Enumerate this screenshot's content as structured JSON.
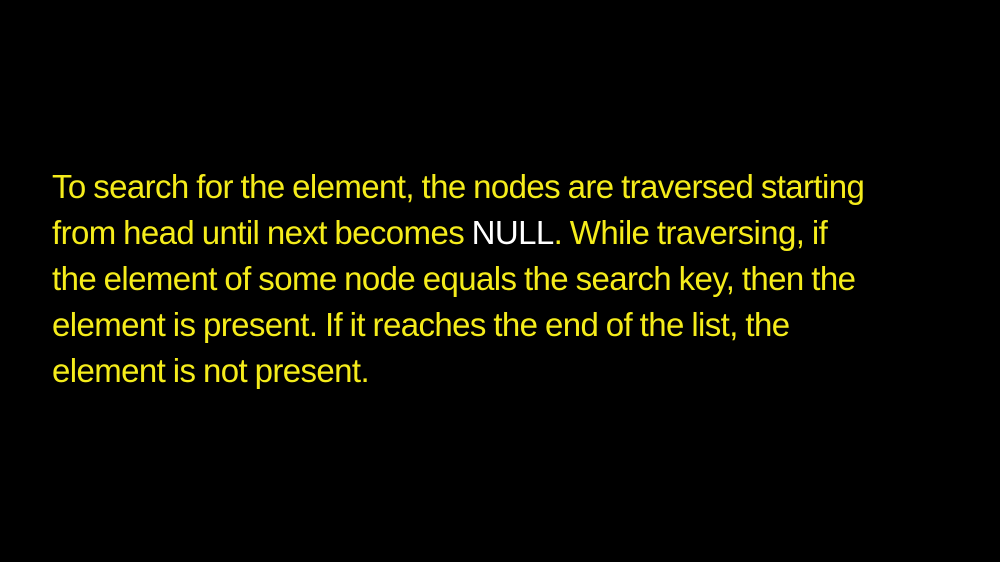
{
  "colors": {
    "background": "#000000",
    "text_primary": "#f5ec1b",
    "text_highlight": "#ffffff"
  },
  "paragraph": {
    "line1": "To search for the element, the nodes are traversed starting",
    "line2_before": "from head until next becomes ",
    "line2_highlight": "NULL",
    "line2_after": ". While traversing, if",
    "line3": "the element of some node equals the search key, then the",
    "line4": "element is present. If it reaches the end of the list, the",
    "line5": "element is not present."
  }
}
